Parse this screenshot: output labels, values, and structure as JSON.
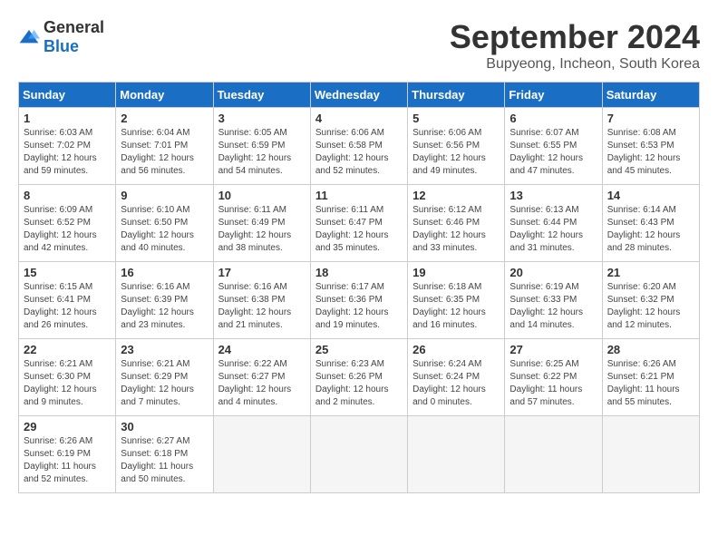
{
  "logo": {
    "general": "General",
    "blue": "Blue"
  },
  "title": "September 2024",
  "location": "Bupyeong, Incheon, South Korea",
  "days_of_week": [
    "Sunday",
    "Monday",
    "Tuesday",
    "Wednesday",
    "Thursday",
    "Friday",
    "Saturday"
  ],
  "weeks": [
    [
      {
        "day": "1",
        "sunrise": "6:03 AM",
        "sunset": "7:02 PM",
        "daylight": "12 hours and 59 minutes."
      },
      {
        "day": "2",
        "sunrise": "6:04 AM",
        "sunset": "7:01 PM",
        "daylight": "12 hours and 56 minutes."
      },
      {
        "day": "3",
        "sunrise": "6:05 AM",
        "sunset": "6:59 PM",
        "daylight": "12 hours and 54 minutes."
      },
      {
        "day": "4",
        "sunrise": "6:06 AM",
        "sunset": "6:58 PM",
        "daylight": "12 hours and 52 minutes."
      },
      {
        "day": "5",
        "sunrise": "6:06 AM",
        "sunset": "6:56 PM",
        "daylight": "12 hours and 49 minutes."
      },
      {
        "day": "6",
        "sunrise": "6:07 AM",
        "sunset": "6:55 PM",
        "daylight": "12 hours and 47 minutes."
      },
      {
        "day": "7",
        "sunrise": "6:08 AM",
        "sunset": "6:53 PM",
        "daylight": "12 hours and 45 minutes."
      }
    ],
    [
      {
        "day": "8",
        "sunrise": "6:09 AM",
        "sunset": "6:52 PM",
        "daylight": "12 hours and 42 minutes."
      },
      {
        "day": "9",
        "sunrise": "6:10 AM",
        "sunset": "6:50 PM",
        "daylight": "12 hours and 40 minutes."
      },
      {
        "day": "10",
        "sunrise": "6:11 AM",
        "sunset": "6:49 PM",
        "daylight": "12 hours and 38 minutes."
      },
      {
        "day": "11",
        "sunrise": "6:11 AM",
        "sunset": "6:47 PM",
        "daylight": "12 hours and 35 minutes."
      },
      {
        "day": "12",
        "sunrise": "6:12 AM",
        "sunset": "6:46 PM",
        "daylight": "12 hours and 33 minutes."
      },
      {
        "day": "13",
        "sunrise": "6:13 AM",
        "sunset": "6:44 PM",
        "daylight": "12 hours and 31 minutes."
      },
      {
        "day": "14",
        "sunrise": "6:14 AM",
        "sunset": "6:43 PM",
        "daylight": "12 hours and 28 minutes."
      }
    ],
    [
      {
        "day": "15",
        "sunrise": "6:15 AM",
        "sunset": "6:41 PM",
        "daylight": "12 hours and 26 minutes."
      },
      {
        "day": "16",
        "sunrise": "6:16 AM",
        "sunset": "6:39 PM",
        "daylight": "12 hours and 23 minutes."
      },
      {
        "day": "17",
        "sunrise": "6:16 AM",
        "sunset": "6:38 PM",
        "daylight": "12 hours and 21 minutes."
      },
      {
        "day": "18",
        "sunrise": "6:17 AM",
        "sunset": "6:36 PM",
        "daylight": "12 hours and 19 minutes."
      },
      {
        "day": "19",
        "sunrise": "6:18 AM",
        "sunset": "6:35 PM",
        "daylight": "12 hours and 16 minutes."
      },
      {
        "day": "20",
        "sunrise": "6:19 AM",
        "sunset": "6:33 PM",
        "daylight": "12 hours and 14 minutes."
      },
      {
        "day": "21",
        "sunrise": "6:20 AM",
        "sunset": "6:32 PM",
        "daylight": "12 hours and 12 minutes."
      }
    ],
    [
      {
        "day": "22",
        "sunrise": "6:21 AM",
        "sunset": "6:30 PM",
        "daylight": "12 hours and 9 minutes."
      },
      {
        "day": "23",
        "sunrise": "6:21 AM",
        "sunset": "6:29 PM",
        "daylight": "12 hours and 7 minutes."
      },
      {
        "day": "24",
        "sunrise": "6:22 AM",
        "sunset": "6:27 PM",
        "daylight": "12 hours and 4 minutes."
      },
      {
        "day": "25",
        "sunrise": "6:23 AM",
        "sunset": "6:26 PM",
        "daylight": "12 hours and 2 minutes."
      },
      {
        "day": "26",
        "sunrise": "6:24 AM",
        "sunset": "6:24 PM",
        "daylight": "12 hours and 0 minutes."
      },
      {
        "day": "27",
        "sunrise": "6:25 AM",
        "sunset": "6:22 PM",
        "daylight": "11 hours and 57 minutes."
      },
      {
        "day": "28",
        "sunrise": "6:26 AM",
        "sunset": "6:21 PM",
        "daylight": "11 hours and 55 minutes."
      }
    ],
    [
      {
        "day": "29",
        "sunrise": "6:26 AM",
        "sunset": "6:19 PM",
        "daylight": "11 hours and 52 minutes."
      },
      {
        "day": "30",
        "sunrise": "6:27 AM",
        "sunset": "6:18 PM",
        "daylight": "11 hours and 50 minutes."
      },
      null,
      null,
      null,
      null,
      null
    ]
  ]
}
